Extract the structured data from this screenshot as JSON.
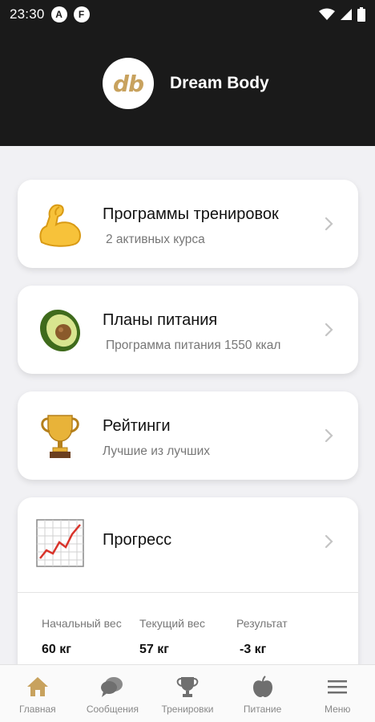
{
  "status_bar": {
    "time": "23:30",
    "badge1": "A",
    "badge2": "F"
  },
  "header": {
    "logo_text": "db",
    "title": "Dream Body"
  },
  "cards": [
    {
      "icon": "flexed-biceps-icon",
      "title": "Программы тренировок",
      "subtitle": "2 активных курса"
    },
    {
      "icon": "avocado-icon",
      "title": "Планы питания",
      "subtitle": "Программа питания 1550 ккал"
    },
    {
      "icon": "trophy-icon",
      "title": "Рейтинги",
      "subtitle": "Лучшие из лучших"
    },
    {
      "icon": "chart-increasing-icon",
      "title": "Прогресс",
      "stats": [
        {
          "label": "Начальный вес",
          "value": "60 кг"
        },
        {
          "label": "Текущий вес",
          "value": "57 кг"
        },
        {
          "label": "Результат",
          "value": "-3 кг"
        }
      ]
    }
  ],
  "bottom_nav": [
    {
      "icon": "home-icon",
      "label": "Главная",
      "active": true
    },
    {
      "icon": "chat-icon",
      "label": "Сообщения"
    },
    {
      "icon": "trophy-icon",
      "label": "Тренировки"
    },
    {
      "icon": "apple-icon",
      "label": "Питание"
    },
    {
      "icon": "menu-icon",
      "label": "Меню"
    }
  ],
  "colors": {
    "header_bg": "#1a1a1a",
    "accent_gold": "#c8a25e",
    "nav_active": "#c8a25e",
    "nav_inactive": "#777777"
  }
}
